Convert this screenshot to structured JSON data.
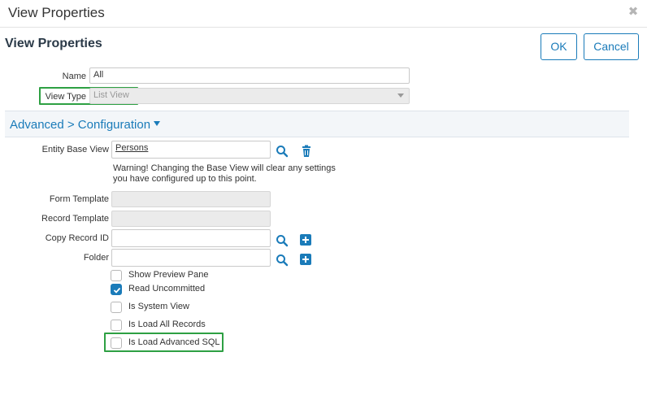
{
  "dialog": {
    "title": "View Properties"
  },
  "header": {
    "heading": "View Properties",
    "ok_label": "OK",
    "cancel_label": "Cancel"
  },
  "fields": {
    "name_label": "Name",
    "name_value": "All",
    "view_type_label": "View Type",
    "view_type_value": "List View"
  },
  "section": {
    "title": "Advanced > Configuration"
  },
  "config": {
    "entity_base_view_label": "Entity Base View",
    "entity_base_view_value": "Persons",
    "warning_line1": "Warning! Changing the Base View will clear any settings",
    "warning_line2": "you have configured up to this point.",
    "form_template_label": "Form Template",
    "record_template_label": "Record Template",
    "copy_record_id_label": "Copy Record ID",
    "folder_label": "Folder"
  },
  "options": [
    {
      "label": "Show Preview Pane",
      "checked": false
    },
    {
      "label": "Read Uncommitted",
      "checked": true
    },
    {
      "label": "Is System View",
      "checked": false
    },
    {
      "label": "Is Load All Records",
      "checked": false
    },
    {
      "label": "Is Load Advanced SQL",
      "checked": false
    }
  ],
  "colors": {
    "accent": "#1a7bb9",
    "highlight": "#2ea043"
  }
}
